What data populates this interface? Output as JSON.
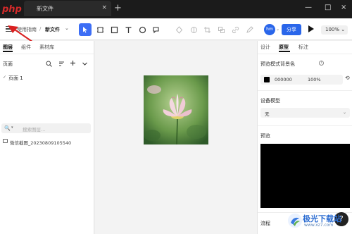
{
  "titlebar": {
    "logo_text": "php",
    "tab_title": "新文件",
    "tab_close": "×",
    "new_tab": "+",
    "window_min": "—",
    "window_max": "□",
    "window_close": "×"
  },
  "toolbar": {
    "breadcrumb_parent": "使用指南",
    "breadcrumb_sep": "/",
    "breadcrumb_current": "新文件",
    "breadcrumb_arrow": "⌄",
    "avatar_label": "hm",
    "avatar_dropdown": "⌄",
    "share_label": "分享",
    "zoom_label": "100% ⌄"
  },
  "left_panel": {
    "tabs": [
      "图层",
      "组件",
      "素材库"
    ],
    "active_tab": "图层",
    "pages_title": "页面",
    "pages": [
      {
        "label": "页面 1",
        "active": true
      }
    ],
    "page_check": "✓",
    "search_placeholder": "搜索图层…",
    "search_icon": "🔍",
    "search_caret": "▾",
    "layers": [
      {
        "label": "微信截图_20230809105540"
      }
    ]
  },
  "right_panel": {
    "tabs": [
      "设计",
      "原型",
      "标注"
    ],
    "active_tab": "原型",
    "bg_label": "预览模式背景色",
    "bg_color_hex": "000000",
    "bg_opacity": "100%",
    "device_label": "设备模型",
    "device_value": "无",
    "device_chevron": "⌄",
    "preview_label": "预览",
    "flow_label": "流程",
    "help_label": "?",
    "reset_icon": "⟲",
    "info_icon": "i"
  },
  "watermark": {
    "text": "极光下载站",
    "url": "www.xz7.com"
  },
  "colors": {
    "accent": "#2a66ea",
    "titlebar": "#1b1b1b",
    "preview_bg": "#000000"
  }
}
